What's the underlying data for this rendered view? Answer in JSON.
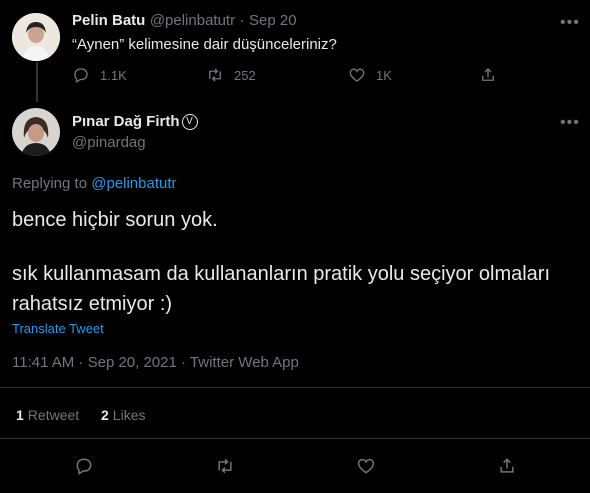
{
  "parent_tweet": {
    "author_name": "Pelin Batu",
    "handle": "@pelinbatutr",
    "separator": "·",
    "date": "Sep 20",
    "text": "“Aynen” kelimesine dair düşünceleriniz?",
    "more": "•••",
    "actions": {
      "reply_count": "1.1K",
      "retweet_count": "252",
      "like_count": "1K"
    }
  },
  "main_tweet": {
    "author_name": "Pınar Dağ Firth",
    "verified_mark": "V",
    "handle": "@pinardag",
    "more": "•••",
    "replying_prefix": "Replying to",
    "replying_to": "@pelinbatutr",
    "text_line1": "bence hiçbir sorun yok.",
    "text_line2": "sık kullanmasam da kullananların pratik yolu seçiyor olmaları rahatsız etmiyor :)",
    "translate": "Translate Tweet",
    "timestamp": "11:41 AM · Sep 20, 2021 · Twitter Web App",
    "stats": {
      "retweets_count": "1",
      "retweets_label": "Retweet",
      "likes_count": "2",
      "likes_label": "Likes"
    }
  },
  "colors": {
    "background": "#000000",
    "accent": "#1d9bf0",
    "muted": "#71767b",
    "divider": "#2f3336"
  }
}
